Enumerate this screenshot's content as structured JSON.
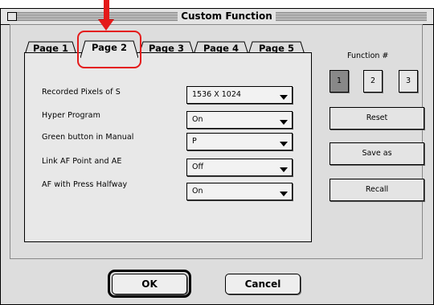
{
  "window": {
    "title": "Custom Function"
  },
  "tabs": [
    {
      "label": "Page 1"
    },
    {
      "label": "Page 2"
    },
    {
      "label": "Page 3"
    },
    {
      "label": "Page 4"
    },
    {
      "label": "Page 5"
    }
  ],
  "fields": [
    {
      "label": "Recorded Pixels of S",
      "value": "1536 X 1024"
    },
    {
      "label": "Hyper Program",
      "value": "On"
    },
    {
      "label": "Green button in Manual",
      "value": "P"
    },
    {
      "label": "Link AF Point and AE",
      "value": "Off"
    },
    {
      "label": "AF with Press Halfway",
      "value": "On"
    }
  ],
  "function_number": {
    "label": "Function #",
    "buttons": [
      "1",
      "2",
      "3"
    ],
    "selected": "1"
  },
  "side_buttons": {
    "reset": "Reset",
    "save_as": "Save as",
    "recall": "Recall"
  },
  "bottom_buttons": {
    "ok": "OK",
    "cancel": "Cancel"
  },
  "annotation": {
    "color": "#e41a1a",
    "highlighted_tab": "Page 2"
  }
}
